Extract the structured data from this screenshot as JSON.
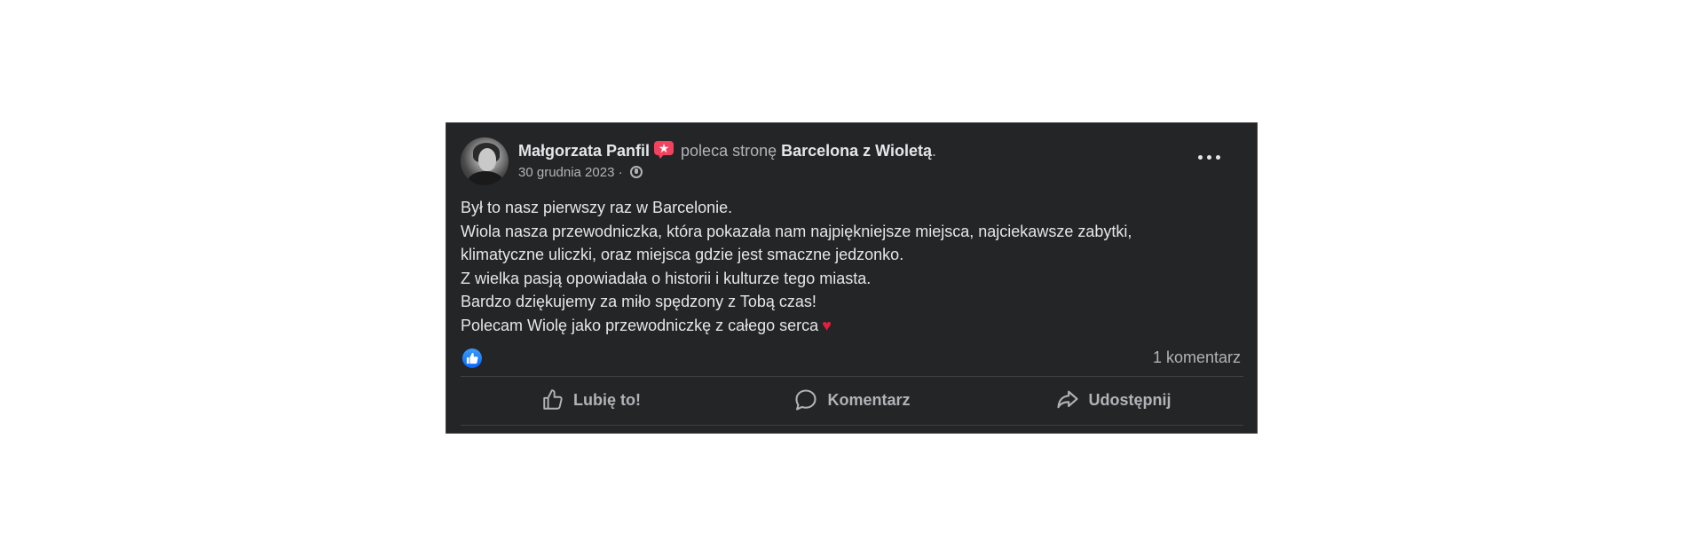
{
  "post": {
    "author": "Małgorzata Panfil",
    "verb": " poleca stronę ",
    "page": "Barcelona z Wioletą",
    "page_suffix": ".",
    "date": "30 grudnia 2023",
    "date_separator": " · ",
    "icons": {
      "recommend": "recommend-star-icon",
      "privacy": "globe-icon",
      "more": "more-options-icon",
      "heart": "red-heart-icon",
      "like": "like-thumb-icon"
    },
    "body_lines": [
      "Był to nasz pierwszy raz w Barcelonie.",
      "Wiola nasza przewodniczka, która pokazała nam najpiękniejsze miejsca, najciekawsze zabytki,",
      "klimatyczne uliczki, oraz miejsca gdzie jest smaczne jedzonko.",
      "Z wielka pasją opowiadała o historii i kulturze tego miasta.",
      "Bardzo dziękujemy za miło spędzony z Tobą czas!",
      "Polecam Wiolę jako przewodniczkę z całego serca"
    ],
    "heart_glyph": "♥",
    "comments_count": "1 komentarz",
    "actions": {
      "like": "Lubię to!",
      "comment": "Komentarz",
      "share": "Udostępnij"
    },
    "colors": {
      "card_bg": "#242526",
      "text": "#e4e6eb",
      "secondary_text": "#b0b3b8",
      "accent_blue": "#0866ff",
      "recommend_red": "#f3425f",
      "heart_red": "#e41e3f"
    }
  }
}
